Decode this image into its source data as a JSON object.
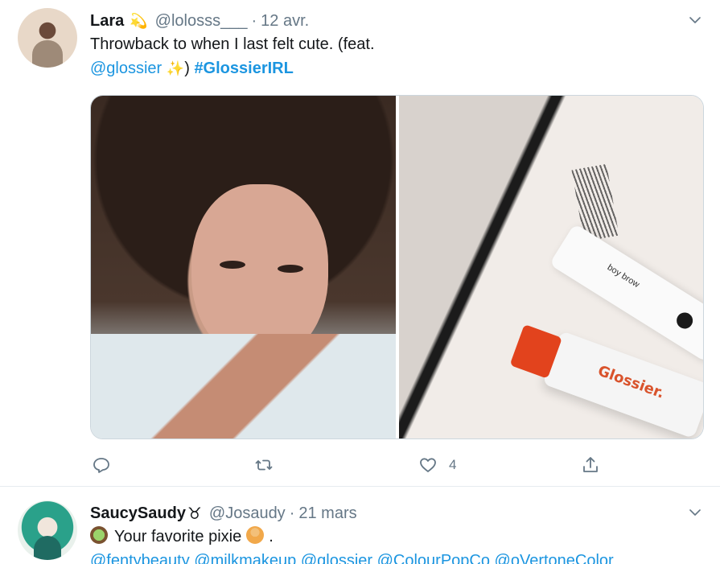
{
  "tweets": [
    {
      "author": {
        "name": "Lara",
        "badge": "💫",
        "handle": "@lolosss___",
        "date": "12 avr."
      },
      "text": {
        "line1": "Throwback to when I last felt cute. (feat.",
        "mention": "@glossier",
        "sparkle": "✨",
        "close_paren": ")",
        "hashtag": "#GlossierIRL"
      },
      "media": {
        "left_image": "selfie-photo",
        "right_image": "glossier-products-photo",
        "tube_label": "Glossier.",
        "brow_label": "boy brow"
      },
      "actions": {
        "reply_icon": "reply-icon",
        "retweet_icon": "retweet-icon",
        "like_icon": "heart-icon",
        "like_count": "4",
        "share_icon": "share-icon"
      }
    },
    {
      "author": {
        "name": "SaucySaudy",
        "badge": "♉",
        "handle": "@Josaudy",
        "date": "21 mars"
      },
      "text": {
        "kiwi": "🥝",
        "line1": "Your favorite pixie",
        "pixie": "🧚",
        "line1_end": ".",
        "line2": "@fentybeauty @milkmakeup @glossier @ColourPopCo @oVertoneColor"
      }
    }
  ],
  "colors": {
    "link": "#1b95e0",
    "secondary_text": "#657786",
    "divider": "#e6ecf0"
  }
}
